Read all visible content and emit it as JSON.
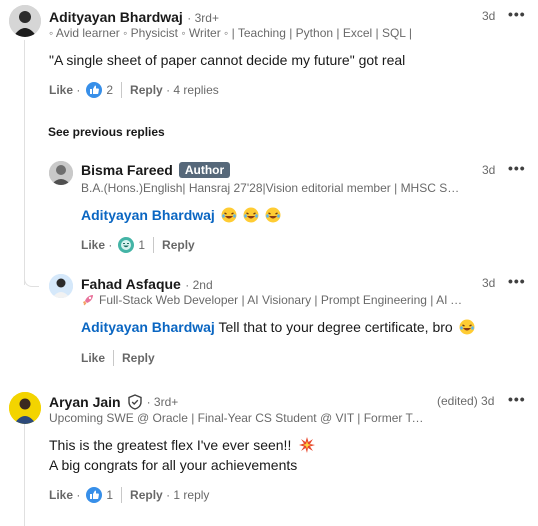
{
  "colors": {
    "link": "#0a66c2",
    "author_badge": "#56687a",
    "like_blue": "#378fe9",
    "funny_teal": "#44b4a6"
  },
  "comments": [
    {
      "name": "Adityayan Bhardwaj",
      "degree": "· 3rd+",
      "headline": "◦ Avid learner ◦ Physicist ◦ Writer ◦ | Teaching | Python | Excel | SQL |",
      "time": "3d",
      "text": "\"A single sheet of paper cannot decide my future\" got real",
      "like_label": "Like",
      "reaction_icon": "like-icon",
      "reaction_count": "2",
      "reply_label": "Reply",
      "replies_count": "4 replies"
    },
    {
      "name": "Aryan Jain",
      "degree": "· 3rd+",
      "headline": "Upcoming SWE @ Oracle | Final-Year CS Student @ VIT | Former Tec...",
      "time": "(edited) 3d",
      "text_line1": "This is the greatest flex I've ever seen!!",
      "text_line2": "A big congrats for all your achievements",
      "like_label": "Like",
      "reaction_icon": "like-icon",
      "reaction_count": "1",
      "reply_label": "Reply",
      "replies_count": "1 reply"
    }
  ],
  "see_previous": "See previous replies",
  "replies": [
    {
      "name": "Bisma Fareed",
      "badge": "Author",
      "headline": "B.A.(Hons.)English| Hansraj 27'28|Vision editorial member | MHSC Socia...",
      "time": "3d",
      "mention": "Adityayan Bhardwaj",
      "text": "",
      "like_label": "Like",
      "reaction_icon": "funny-icon",
      "reaction_count": "1",
      "reply_label": "Reply"
    },
    {
      "name": "Fahad Asfaque",
      "degree": "· 2nd",
      "headline": "Full-Stack Web Developer | AI Visionary | Prompt Engineering | AI A...",
      "time": "3d",
      "mention": "Adityayan Bhardwaj",
      "text": " Tell that to your degree certificate, bro",
      "like_label": "Like",
      "reply_label": "Reply"
    }
  ]
}
